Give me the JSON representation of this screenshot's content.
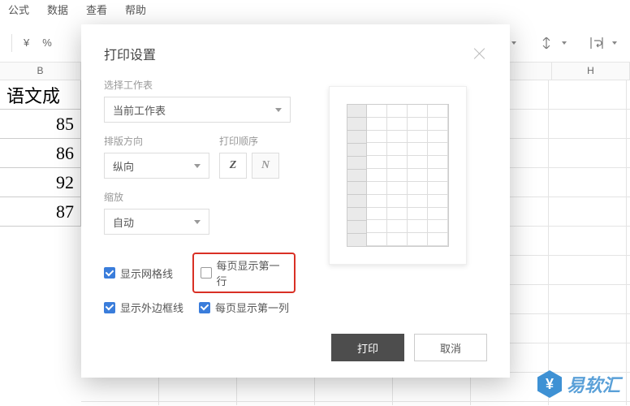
{
  "menubar": [
    "公式",
    "数据",
    "查看",
    "帮助"
  ],
  "toolbar": {
    "currency": "¥",
    "percent": "%"
  },
  "sheet": {
    "col_b_label": "B",
    "col_h_label": "H",
    "cells": [
      "语文成",
      "85",
      "86",
      "92",
      "87"
    ]
  },
  "dialog": {
    "title": "打印设置",
    "select_worksheet_label": "选择工作表",
    "select_worksheet_value": "当前工作表",
    "orientation_label": "排版方向",
    "orientation_value": "纵向",
    "print_order_label": "打印顺序",
    "order_btn_z": "Z",
    "order_btn_n": "N",
    "scaling_label": "缩放",
    "scaling_value": "自动",
    "chk_gridlines": "显示网格线",
    "chk_first_row": "每页显示第一行",
    "chk_outer_border": "显示外边框线",
    "chk_first_col": "每页显示第一列",
    "print_btn": "打印",
    "cancel_btn": "取消"
  },
  "watermark": "易软汇"
}
